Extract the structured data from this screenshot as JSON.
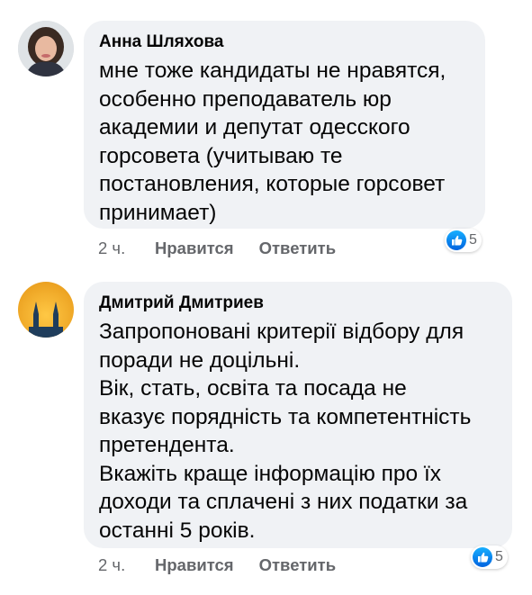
{
  "colors": {
    "bubble": "#f0f2f5",
    "text": "#050505",
    "meta": "#65676b",
    "like_blue": "#1877f2"
  },
  "comments": [
    {
      "author": "Анна Шляхова",
      "lines": [
        "мне тоже кандидаты не нравятся,",
        "особенно преподаватель юр",
        "академии и депутат одесского",
        "горсовета (учитываю те",
        "постановления, которые горсовет",
        "принимает)"
      ],
      "time": "2 ч.",
      "like_label": "Нравится",
      "reply_label": "Ответить",
      "reaction_icon": "like-icon",
      "reaction_count": "5"
    },
    {
      "author": "Дмитрий Дмитриев",
      "lines": [
        "Запропоновані критерії відбору для",
        "поради не доцільні.",
        "Вік, стать, освіта та посада не",
        "вказує порядність та компетентність",
        "претендента.",
        "Вкажіть краще інформацію про їх",
        "доходи та сплачені з них податки за",
        "останні 5 років."
      ],
      "time": "2 ч.",
      "like_label": "Нравится",
      "reply_label": "Ответить",
      "reaction_icon": "like-icon",
      "reaction_count": "5"
    }
  ]
}
